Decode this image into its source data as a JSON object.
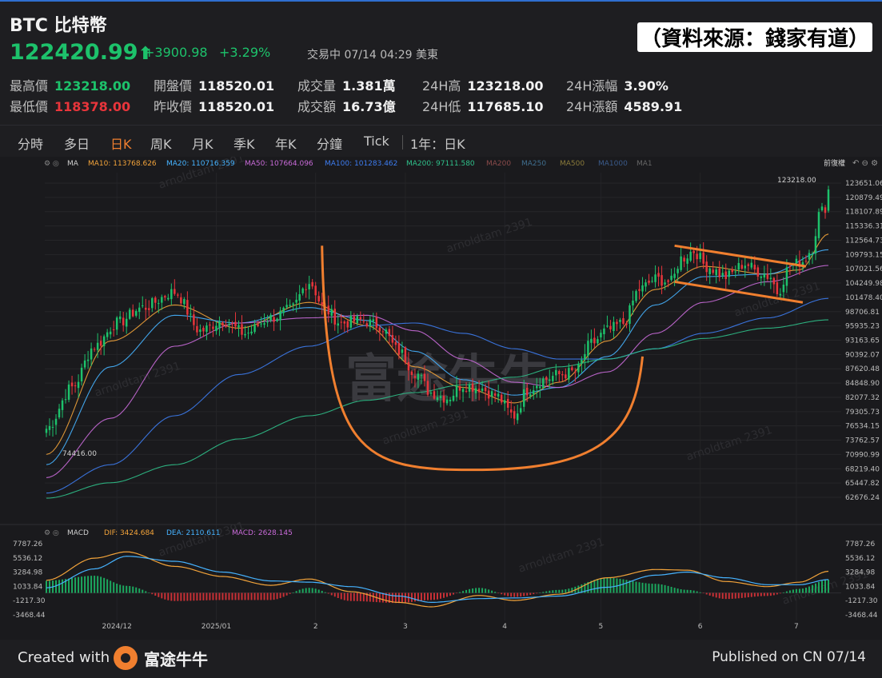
{
  "header": {
    "title": "BTC 比特幣",
    "source_note": "（資料來源：錢家有道）",
    "price": "122420.99",
    "change_abs": "+3900.98",
    "change_pct": "+3.29%",
    "status": "交易中 07/14 04:29 美東",
    "stats": {
      "high_label": "最高價",
      "high_value": "123218.00",
      "low_label": "最低價",
      "low_value": "118378.00",
      "open_label": "開盤價",
      "open_value": "118520.01",
      "prev_close_label": "昨收價",
      "prev_close_value": "118520.01",
      "volume_label": "成交量",
      "volume_value": "1.381萬",
      "amount_label": "成交額",
      "amount_value": "16.73億",
      "h24_high_label": "24H高",
      "h24_high_value": "123218.00",
      "h24_low_label": "24H低",
      "h24_low_value": "117685.10",
      "h24_range_pct_label": "24H漲幅",
      "h24_range_pct_value": "3.90%",
      "h24_range_amt_label": "24H漲額",
      "h24_range_amt_value": "4589.91"
    }
  },
  "tabs": [
    {
      "label": "分時",
      "active": false
    },
    {
      "label": "多日",
      "active": false
    },
    {
      "label": "日K",
      "active": true
    },
    {
      "label": "周K",
      "active": false
    },
    {
      "label": "月K",
      "active": false
    },
    {
      "label": "季K",
      "active": false
    },
    {
      "label": "年K",
      "active": false
    },
    {
      "label": "分鐘",
      "active": false
    },
    {
      "label": "Tick",
      "active": false
    }
  ],
  "period_label": "1年：日K",
  "legend": {
    "ma": "MA",
    "ma10": "MA10: 113768.626",
    "ma20": "MA20: 110716.359",
    "ma50": "MA50: 107664.096",
    "ma100": "MA100: 101283.462",
    "ma200": "MA200: 97111.580",
    "ma200b": "MA200",
    "ma250": "MA250",
    "ma500": "MA500",
    "ma1000": "MA1000",
    "ma1": "MA1",
    "prepost": "前復權",
    "macd": "MACD",
    "dif": "DIF: 3424.684",
    "dea": "DEA: 2110.611",
    "macd_val": "MACD: 2628.145"
  },
  "annotations": {
    "high_label": "123218.00",
    "low_label": "74416.00",
    "watermark": "arnoldtam 2391",
    "bg_watermark": "富途牛牛"
  },
  "colors": {
    "up": "#1dc26b",
    "down": "#e8353b",
    "accent": "#f07f2f",
    "ma10": "#f2a33a",
    "ma20": "#46b3ff",
    "ma50": "#c86ad8",
    "ma100": "#3d7cf0",
    "ma200": "#2fc08a"
  },
  "footer": {
    "created_with": "Created with",
    "brand": "富途牛牛",
    "published": "Published on CN 07/14"
  },
  "chart_data": {
    "type": "candlestick",
    "price_axis_ticks": [
      123651.06,
      120879.49,
      118107.89,
      115336.31,
      112564.73,
      109793.15,
      107021.56,
      104249.98,
      101478.4,
      98706.81,
      95935.23,
      93163.65,
      90392.07,
      87620.48,
      84848.9,
      82077.32,
      79305.73,
      76534.15,
      73762.57,
      70990.99,
      68219.4,
      65447.82,
      62676.24
    ],
    "price_axis_labels": [
      "123651.06",
      "120879.49",
      "118107.89",
      "115336.31",
      "112564.73",
      "109793.15",
      "107021.56",
      "104249.98",
      "101478.40",
      "98706.81",
      "95935.23",
      "93163.65",
      "90392.07",
      "87620.48",
      "84848.90",
      "82077.32",
      "79305.73",
      "76534.15",
      "73762.57",
      "70990.99",
      "68219.40",
      "65447.82",
      "62676.24"
    ],
    "macd_axis_ticks": [
      7787.26,
      5536.12,
      3284.98,
      1033.84,
      -1217.3,
      -3468.44
    ],
    "macd_axis_labels": [
      "7787.26",
      "5536.12",
      "3284.98",
      "1033.84",
      "-1217.30",
      "-3468.44"
    ],
    "x_axis_labels": [
      "2024/12",
      "2025/01",
      "2",
      "3",
      "4",
      "5",
      "6",
      "7"
    ],
    "x_label_days": [
      22,
      53,
      84,
      112,
      143,
      173,
      204,
      234
    ],
    "day_count": 245,
    "close_anchors": [
      [
        0,
        76000
      ],
      [
        8,
        84000
      ],
      [
        15,
        92000
      ],
      [
        22,
        96500
      ],
      [
        30,
        99500
      ],
      [
        40,
        102500
      ],
      [
        48,
        95000
      ],
      [
        55,
        97000
      ],
      [
        62,
        94500
      ],
      [
        70,
        97500
      ],
      [
        76,
        99000
      ],
      [
        82,
        104500
      ],
      [
        87,
        99000
      ],
      [
        92,
        96500
      ],
      [
        98,
        97000
      ],
      [
        104,
        96000
      ],
      [
        110,
        91000
      ],
      [
        115,
        87000
      ],
      [
        120,
        83000
      ],
      [
        125,
        82000
      ],
      [
        130,
        84500
      ],
      [
        135,
        84000
      ],
      [
        140,
        82500
      ],
      [
        146,
        78500
      ],
      [
        150,
        83500
      ],
      [
        155,
        85500
      ],
      [
        160,
        86500
      ],
      [
        165,
        87000
      ],
      [
        170,
        92500
      ],
      [
        175,
        95000
      ],
      [
        180,
        96500
      ],
      [
        185,
        103000
      ],
      [
        190,
        105000
      ],
      [
        195,
        104500
      ],
      [
        198,
        109000
      ],
      [
        202,
        110500
      ],
      [
        206,
        107500
      ],
      [
        212,
        105500
      ],
      [
        218,
        108000
      ],
      [
        222,
        106500
      ],
      [
        226,
        105500
      ],
      [
        228,
        102500
      ],
      [
        232,
        107500
      ],
      [
        236,
        108500
      ],
      [
        239,
        111000
      ],
      [
        241,
        117500
      ],
      [
        243,
        119000
      ],
      [
        244,
        122420
      ]
    ],
    "ma_anchors": {
      "ma10": [
        [
          0,
          71000
        ],
        [
          20,
          93000
        ],
        [
          40,
          100000
        ],
        [
          60,
          95500
        ],
        [
          82,
          100500
        ],
        [
          100,
          96000
        ],
        [
          115,
          88000
        ],
        [
          130,
          84000
        ],
        [
          146,
          81000
        ],
        [
          160,
          85000
        ],
        [
          175,
          93000
        ],
        [
          190,
          103000
        ],
        [
          205,
          107500
        ],
        [
          225,
          106000
        ],
        [
          235,
          106800
        ],
        [
          244,
          113769
        ]
      ],
      "ma20": [
        [
          0,
          69000
        ],
        [
          20,
          88000
        ],
        [
          40,
          98000
        ],
        [
          60,
          96500
        ],
        [
          82,
          99500
        ],
        [
          100,
          97000
        ],
        [
          115,
          91000
        ],
        [
          130,
          85500
        ],
        [
          146,
          82500
        ],
        [
          160,
          84000
        ],
        [
          175,
          90000
        ],
        [
          190,
          100000
        ],
        [
          205,
          105500
        ],
        [
          225,
          106000
        ],
        [
          244,
          110716
        ]
      ],
      "ma50": [
        [
          0,
          66500
        ],
        [
          20,
          78000
        ],
        [
          40,
          92000
        ],
        [
          60,
          96500
        ],
        [
          82,
          97500
        ],
        [
          100,
          98000
        ],
        [
          115,
          95000
        ],
        [
          130,
          89500
        ],
        [
          146,
          85000
        ],
        [
          160,
          84000
        ],
        [
          175,
          87000
        ],
        [
          190,
          94500
        ],
        [
          205,
          100500
        ],
        [
          225,
          104500
        ],
        [
          244,
          107664
        ]
      ],
      "ma100": [
        [
          0,
          63500
        ],
        [
          20,
          69000
        ],
        [
          40,
          78500
        ],
        [
          60,
          86500
        ],
        [
          82,
          92000
        ],
        [
          100,
          96000
        ],
        [
          115,
          96500
        ],
        [
          130,
          94500
        ],
        [
          146,
          91500
        ],
        [
          160,
          89500
        ],
        [
          175,
          89500
        ],
        [
          190,
          91500
        ],
        [
          205,
          94500
        ],
        [
          225,
          97500
        ],
        [
          244,
          101283
        ]
      ],
      "ma200": [
        [
          0,
          62500
        ],
        [
          20,
          65500
        ],
        [
          40,
          69000
        ],
        [
          60,
          74000
        ],
        [
          82,
          78500
        ],
        [
          100,
          81500
        ],
        [
          115,
          83000
        ],
        [
          130,
          84500
        ],
        [
          146,
          86000
        ],
        [
          160,
          88000
        ],
        [
          175,
          89500
        ],
        [
          190,
          91500
        ],
        [
          205,
          93500
        ],
        [
          225,
          95500
        ],
        [
          244,
          97112
        ]
      ]
    },
    "macd_anchors": {
      "dif": [
        [
          0,
          2000
        ],
        [
          15,
          5500
        ],
        [
          25,
          6500
        ],
        [
          40,
          4200
        ],
        [
          55,
          2600
        ],
        [
          70,
          1200
        ],
        [
          82,
          2200
        ],
        [
          95,
          200
        ],
        [
          110,
          -1500
        ],
        [
          120,
          -2200
        ],
        [
          135,
          -400
        ],
        [
          146,
          -1200
        ],
        [
          160,
          -200
        ],
        [
          175,
          2400
        ],
        [
          190,
          3700
        ],
        [
          200,
          3600
        ],
        [
          212,
          1800
        ],
        [
          225,
          1000
        ],
        [
          235,
          1700
        ],
        [
          244,
          3425
        ]
      ],
      "dea": [
        [
          0,
          800
        ],
        [
          15,
          3800
        ],
        [
          25,
          5800
        ],
        [
          40,
          5000
        ],
        [
          55,
          3300
        ],
        [
          70,
          1900
        ],
        [
          82,
          1700
        ],
        [
          95,
          1000
        ],
        [
          110,
          -500
        ],
        [
          120,
          -1500
        ],
        [
          135,
          -900
        ],
        [
          146,
          -800
        ],
        [
          160,
          -500
        ],
        [
          175,
          900
        ],
        [
          190,
          2800
        ],
        [
          200,
          3300
        ],
        [
          212,
          2400
        ],
        [
          225,
          1300
        ],
        [
          235,
          1300
        ],
        [
          244,
          2111
        ]
      ]
    },
    "cup_pattern": {
      "start": [
        86,
        111500
      ],
      "bottom": [
        133,
        68000
      ],
      "end": [
        186,
        90000
      ]
    },
    "flag_upper": [
      [
        196,
        111500
      ],
      [
        237,
        107500
      ]
    ],
    "flag_lower": [
      [
        196,
        104500
      ],
      [
        236,
        100500
      ]
    ]
  }
}
